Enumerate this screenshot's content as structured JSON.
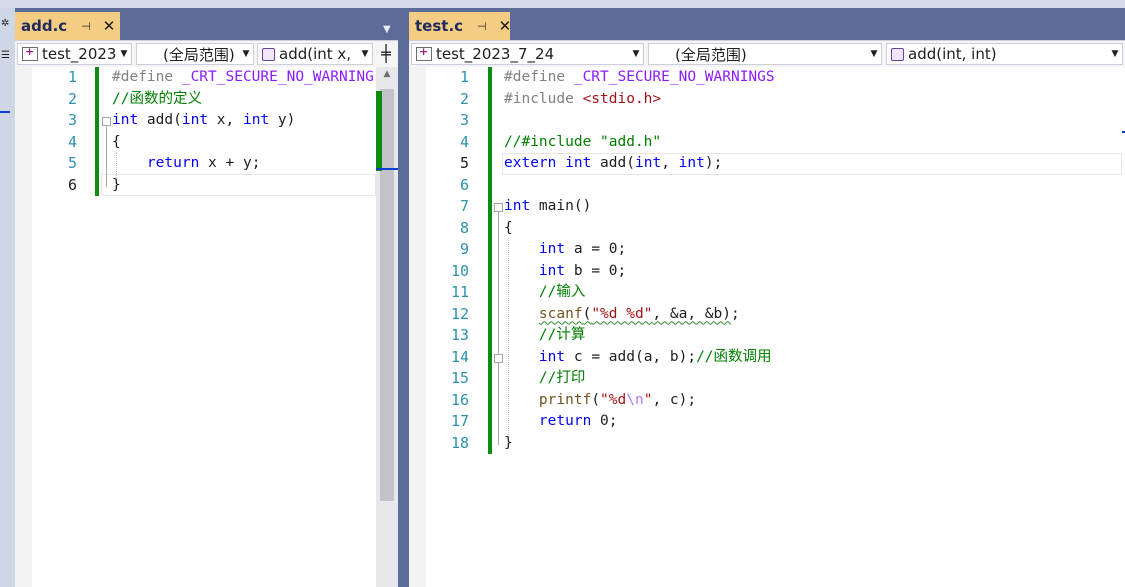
{
  "left_pane": {
    "tab": {
      "name": "add.c",
      "pin_icon": "pin-icon",
      "close_icon": "close-icon"
    },
    "nav": {
      "project": "test_2023",
      "scope": "(全局范围)",
      "member": "add(int x,"
    },
    "line_numbers": [
      "1",
      "2",
      "3",
      "4",
      "5",
      "6"
    ],
    "current_line": "6"
  },
  "right_pane": {
    "tab": {
      "name": "test.c",
      "pin_icon": "pin-icon",
      "close_icon": "close-icon"
    },
    "nav": {
      "project": "test_2023_7_24",
      "scope": "(全局范围)",
      "member": "add(int, int)"
    },
    "line_numbers": [
      "1",
      "2",
      "3",
      "4",
      "5",
      "6",
      "7",
      "8",
      "9",
      "10",
      "11",
      "12",
      "13",
      "14",
      "15",
      "16",
      "17",
      "18"
    ],
    "current_line": "5"
  },
  "left_code": {
    "l1_define": "#define",
    "l1_macro": " _CRT_SECURE_NO_WARNING",
    "l2_comment": "//函数的定义",
    "l3_int1": "int",
    "l3_mid": " add(",
    "l3_int2": "int",
    "l3_x": " x, ",
    "l3_int3": "int",
    "l3_y": " y)",
    "l4": "{",
    "l5_return": "return",
    "l5_expr": " x + y;",
    "l6": "}"
  },
  "right_code": {
    "l1_define": "#define",
    "l1_macro": " _CRT_SECURE_NO_WARNINGS",
    "l2_include": "#include ",
    "l2_header": "<stdio.h>",
    "l4_comment": "//#include \"add.h\"",
    "l5_extern": "extern",
    "l5_sp": " ",
    "l5_int": "int",
    "l5_add": " add(",
    "l5_int2": "int",
    "l5_comma": ", ",
    "l5_int3": "int",
    "l5_end": ");",
    "l7_int": "int",
    "l7_main": " main()",
    "l8": "{",
    "l9_int": "int",
    "l9_rest": " a = 0;",
    "l10_int": "int",
    "l10_rest": " b = 0;",
    "l11_comment": "//输入",
    "l12_scanf": "scanf",
    "l12_open": "(",
    "l12_fmt": "\"%d %d\"",
    "l12_rest": ", &a, &b)",
    "l12_semi": ";",
    "l13_comment": "//计算",
    "l14_int": "int",
    "l14_rest": " c = add(a, b);",
    "l14_comment": "//函数调用",
    "l15_comment": "//打印",
    "l16_printf": "printf",
    "l16_open": "(",
    "l16_fmt1": "\"%d",
    "l16_esc": "\\n",
    "l16_fmt2": "\"",
    "l16_rest": ", c);",
    "l17_return": "return",
    "l17_rest": " 0;",
    "l18": "}"
  },
  "colors": {
    "keyword": "#0000ff",
    "preprocessor": "#808080",
    "macro": "#8a1bff",
    "comment": "#008000",
    "string": "#a31515",
    "line_number": "#2b91af",
    "change_bar": "#108a10",
    "active_tab": "#f5cc84",
    "chrome": "#5d6b99"
  }
}
